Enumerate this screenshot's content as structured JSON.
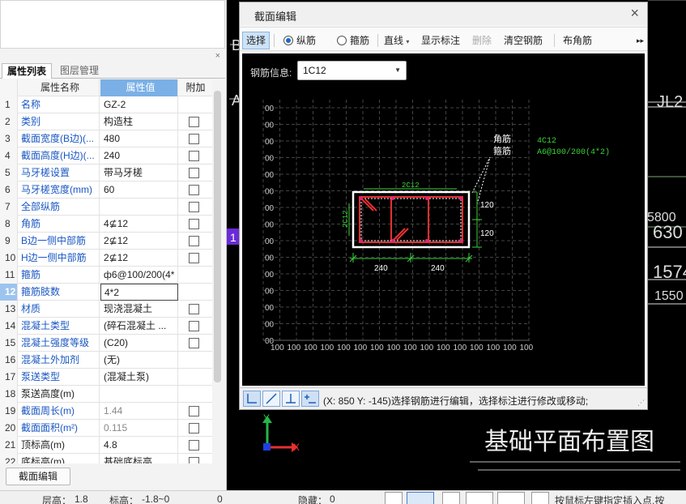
{
  "left_panel": {
    "close": "×",
    "tabs": {
      "active": "属性列表",
      "inactive": "图层管理"
    },
    "columns": {
      "name": "属性名称",
      "value": "属性值",
      "add": "附加"
    },
    "rows": [
      {
        "idx": "1",
        "name": "名称",
        "value": "GZ-2",
        "checkbox": false,
        "blue": true
      },
      {
        "idx": "2",
        "name": "类别",
        "value": "构造柱",
        "checkbox": true,
        "blue": true
      },
      {
        "idx": "3",
        "name": "截面宽度(B边)(...",
        "value": "480",
        "checkbox": true,
        "blue": true
      },
      {
        "idx": "4",
        "name": "截面高度(H边)(...",
        "value": "240",
        "checkbox": true,
        "blue": true
      },
      {
        "idx": "5",
        "name": "马牙槎设置",
        "value": "带马牙槎",
        "checkbox": true,
        "blue": true
      },
      {
        "idx": "6",
        "name": "马牙槎宽度(mm)",
        "value": "60",
        "checkbox": true,
        "blue": true
      },
      {
        "idx": "7",
        "name": "全部纵筋",
        "value": "",
        "checkbox": true,
        "blue": true
      },
      {
        "idx": "8",
        "name": "角筋",
        "value": "4⊈12",
        "checkbox": true,
        "blue": true
      },
      {
        "idx": "9",
        "name": "B边一侧中部筋",
        "value": "2⊈12",
        "checkbox": true,
        "blue": true
      },
      {
        "idx": "10",
        "name": "H边一侧中部筋",
        "value": "2⊈12",
        "checkbox": true,
        "blue": true
      },
      {
        "idx": "11",
        "name": "箍筋",
        "value": "ф6@100/200(4*",
        "checkbox": false,
        "blue": true
      },
      {
        "idx": "12",
        "name": "箍筋肢数",
        "value": "4*2",
        "checkbox": false,
        "blue": true,
        "selected": true
      },
      {
        "idx": "13",
        "name": "材质",
        "value": "现浇混凝土",
        "checkbox": true,
        "blue": true
      },
      {
        "idx": "14",
        "name": "混凝土类型",
        "value": "(碎石混凝土 ...",
        "checkbox": true,
        "blue": true
      },
      {
        "idx": "15",
        "name": "混凝土强度等级",
        "value": "(C20)",
        "checkbox": true,
        "blue": true
      },
      {
        "idx": "16",
        "name": "混凝土外加剂",
        "value": "(无)",
        "checkbox": false,
        "blue": true
      },
      {
        "idx": "17",
        "name": "泵送类型",
        "value": "(混凝土泵)",
        "checkbox": false,
        "blue": true
      },
      {
        "idx": "18",
        "name": "泵送高度(m)",
        "value": "",
        "checkbox": false,
        "blue": false
      },
      {
        "idx": "19",
        "name": "截面周长(m)",
        "value": "1.44",
        "checkbox": true,
        "blue": true,
        "gray": true
      },
      {
        "idx": "20",
        "name": "截面面积(m²)",
        "value": "0.115",
        "checkbox": true,
        "blue": true,
        "gray": true
      },
      {
        "idx": "21",
        "name": "顶标高(m)",
        "value": "4.8",
        "checkbox": true,
        "blue": false
      },
      {
        "idx": "22",
        "name": "底标高(m)",
        "value": "基础底标高",
        "checkbox": true,
        "blue": false
      }
    ],
    "section_edit_button": "截面编辑"
  },
  "dialog": {
    "title": "截面编辑",
    "close": "×",
    "toolbar": {
      "select": "选择",
      "longitudinal": "纵筋",
      "stirrup": "箍筋",
      "line": "直线",
      "show_label": "显示标注",
      "delete": "删除",
      "clear": "清空钢筋",
      "corner": "布角筋",
      "more": "▸▸"
    },
    "rebar_info_label": "钢筋信息:",
    "rebar_info_value": "1C12",
    "drawing": {
      "grid_labels_left": [
        "00",
        "00",
        "00",
        "00",
        "00",
        "00",
        "00",
        "00",
        "00",
        "00",
        "00",
        "00",
        "00",
        "00",
        "00"
      ],
      "grid_labels_bottom": [
        "100",
        "100",
        "100",
        "100",
        "100",
        "100",
        "100",
        "100",
        "100",
        "100",
        "100",
        "100",
        "100",
        "100",
        "100",
        "100"
      ],
      "corner_label": "角筋",
      "stirrup_label": "箍筋",
      "corner_spec": "4C12",
      "stirrup_spec": "A6@100/200(4*2)",
      "top_rebar": "2C12",
      "side_rebar": "2C12",
      "dim_right_1": "120",
      "dim_right_2": "120",
      "dim_bottom_1": "240",
      "dim_bottom_2": "240"
    },
    "coord_text": "(X: 850 Y: -145)选择钢筋进行编辑，选择标注进行修改或移动;"
  },
  "cad": {
    "labels": {
      "jl2": "JL2",
      "b": "B",
      "a": "A",
      "n1": "1",
      "n5800": "5800",
      "n630": "630",
      "n1574": "1574",
      "n1550": "1550",
      "plan_title": "基础平面布置图",
      "axis_x": "X",
      "axis_y": "Y"
    }
  },
  "statusbar": {
    "floor_height": "层高：",
    "floor_height_val": "1.8",
    "elev": "标高：",
    "elev_val": "-1.8~0",
    "zero": "0",
    "hidden": "隐藏：",
    "hidden_val": "0",
    "hint": "按鼠标左键指定插入点,按"
  }
}
